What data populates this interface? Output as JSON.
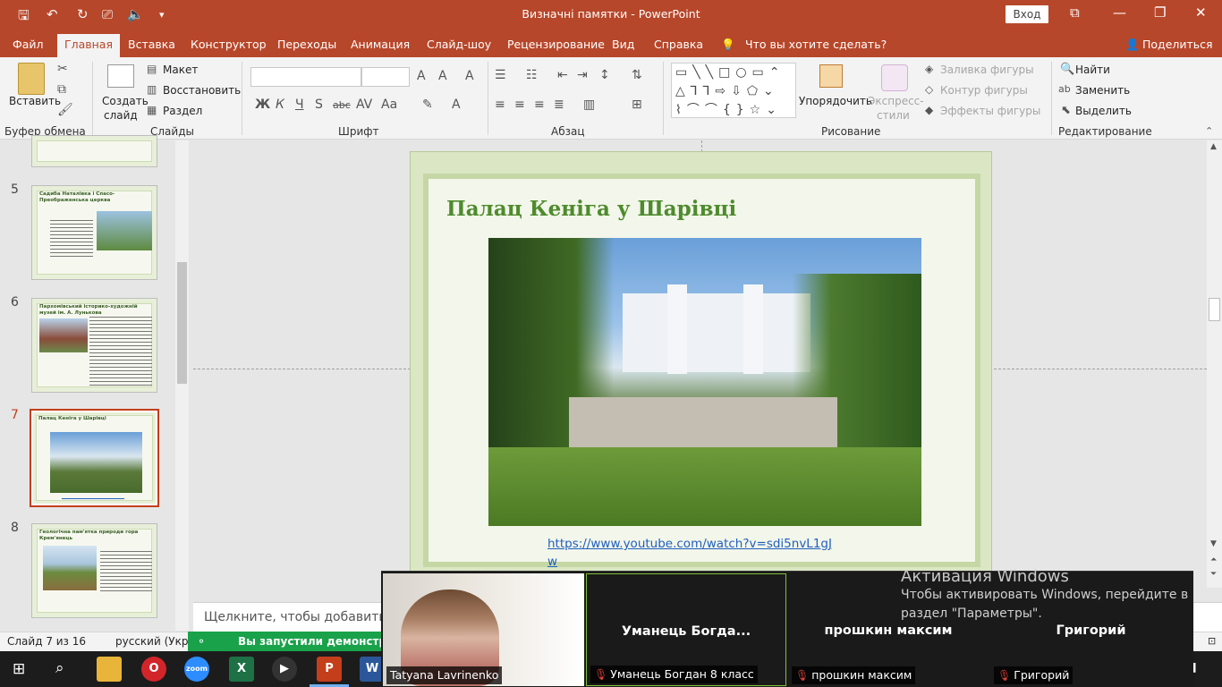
{
  "titlebar": {
    "title": "Визначні памятки  -  PowerPoint",
    "signin": "Вход"
  },
  "tabs": [
    "Файл",
    "Главная",
    "Вставка",
    "Конструктор",
    "Переходы",
    "Анимация",
    "Слайд-шоу",
    "Рецензирование",
    "Вид",
    "Справка",
    "Что вы хотите сделать?"
  ],
  "share": "Поделиться",
  "ribbon": {
    "paste": "Вставить",
    "clipboard_group": "Буфер обмена",
    "new_slide_1": "Создать",
    "new_slide_2": "слайд",
    "layout": "Макет",
    "reset": "Восстановить",
    "section": "Раздел",
    "slides_group": "Слайды",
    "font_group": "Шрифт",
    "paragraph_group": "Абзац",
    "arrange": "Упорядочить",
    "quick_styles_1": "Экспресс-",
    "quick_styles_2": "стили",
    "shape_fill": "Заливка фигуры",
    "shape_outline": "Контур фигуры",
    "shape_effects": "Эффекты фигуры",
    "drawing_group": "Рисование",
    "find": "Найти",
    "replace": "Заменить",
    "select": "Выделить",
    "editing_group": "Редактирование"
  },
  "thumbnails": [
    {
      "num": "5",
      "title": "Садиба Наталівка і Спасо-Преображенська церква"
    },
    {
      "num": "6",
      "title": "Пархомівський історико-художній музей ім. А. Лунькова"
    },
    {
      "num": "7",
      "title": "Палац Кеніга у Шарівці"
    },
    {
      "num": "8",
      "title": "Геологічна пам'ятка природи гора Крем'янець"
    }
  ],
  "slide": {
    "title": "Палац Кеніга у Шарівці",
    "link": "https://www.youtube.com/watch?v=sdi5nvL1gJw"
  },
  "notes_placeholder": "Щелкните, чтобы добавить за",
  "status": {
    "slide_of": "Слайд 7 из 16",
    "language": "русский (Украи",
    "banner": "Вы запустили демонстрации"
  },
  "zoom": {
    "tiles": [
      {
        "name": "",
        "caption": "Tatyana Lavrinenko"
      },
      {
        "name": "Уманець  Богда...",
        "caption": "Уманець Богдан 8 класс"
      },
      {
        "name": "прошкин максим",
        "caption": "прошкин максим"
      },
      {
        "name": "Григорий",
        "caption": "Григорий"
      }
    ]
  },
  "activation": {
    "heading": "Активация Windows",
    "line1": "Чтобы активировать Windows, перейдите в",
    "line2": "раздел \"Параметры\"."
  },
  "colors": {
    "accent": "#b7472a",
    "slide_title": "#4e8b2d",
    "link": "#1f5fbf",
    "zoom_bg": "#1a1a1a",
    "banner": "#1aa24a"
  }
}
